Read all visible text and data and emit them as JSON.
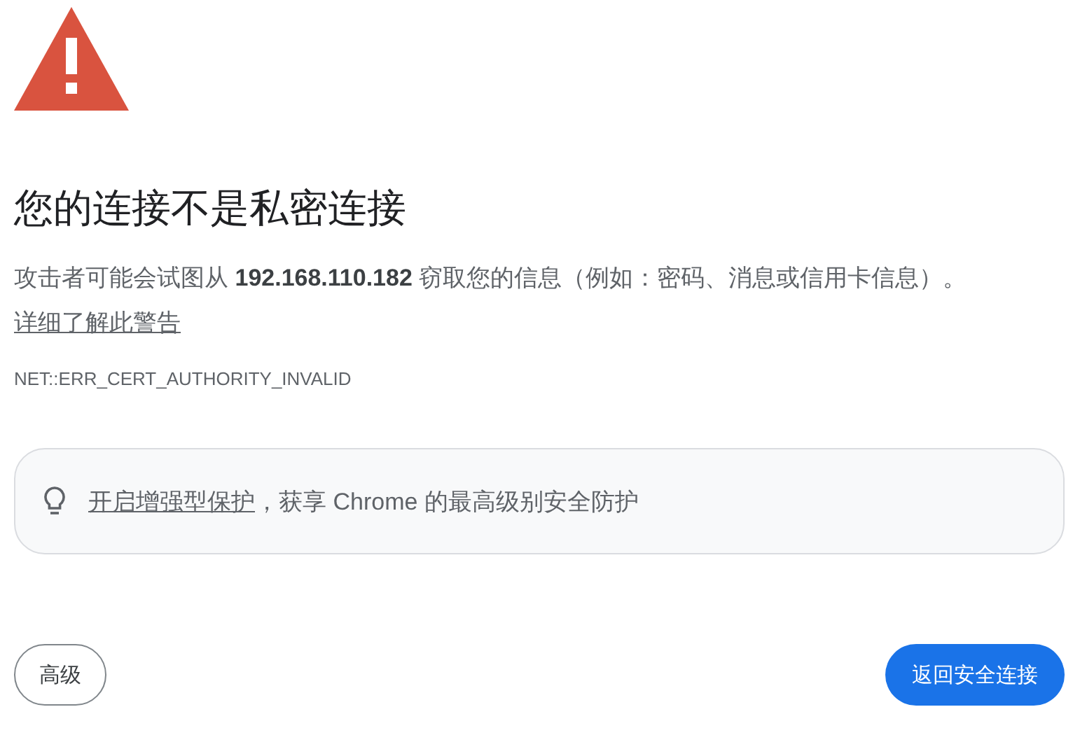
{
  "heading": "您的连接不是私密连接",
  "message": {
    "text": "攻击者可能会试图从 **192.168.110.182** 窃取您的信息（例如：密码、消息或信用卡信息）。",
    "link": "详细了解此警告"
  },
  "error_code": "NET::ERR_CERT_AUTHORITY_INVALID",
  "tip": {
    "link": "开启增强型保护",
    "text": "，获享 Chrome 的最高级别安全防护"
  },
  "buttons": [
    {
      "label": "高级",
      "kind": "secondary"
    },
    {
      "label": "返回安全连接",
      "kind": "primary"
    }
  ]
}
